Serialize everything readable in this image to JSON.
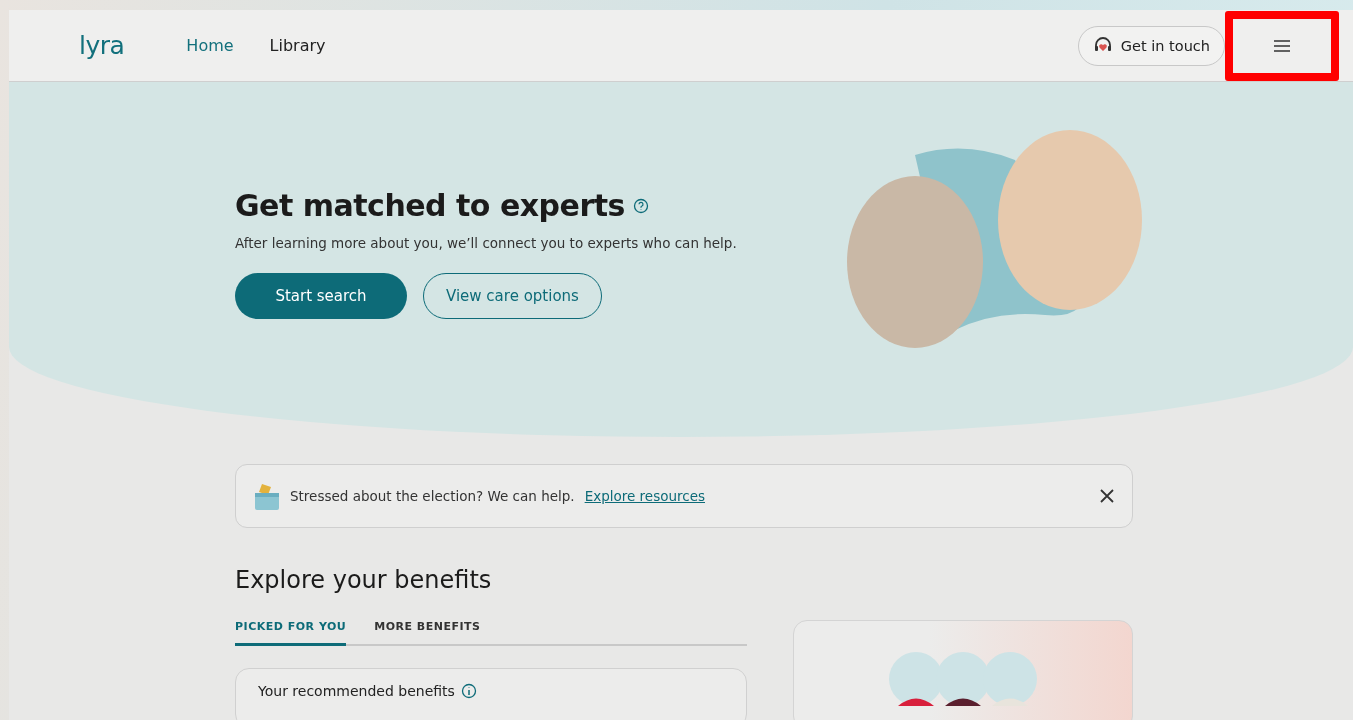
{
  "header": {
    "logo": "lyra",
    "nav": [
      {
        "label": "Home",
        "selected": true
      },
      {
        "label": "Library",
        "selected": false
      }
    ],
    "contact_button": "Get in touch",
    "menu_button": {
      "highlighted": true
    }
  },
  "hero": {
    "title": "Get matched to experts",
    "subtitle": "After learning more about you, we’ll connect you to experts who can help.",
    "buttons": [
      {
        "label": "Start search",
        "kind": "primary"
      },
      {
        "label": "View care options",
        "kind": "secondary"
      }
    ]
  },
  "banner": {
    "text": "Stressed about the election? We can help.",
    "link": "Explore resources"
  },
  "benefits": {
    "title": "Explore your benefits",
    "tabs": [
      {
        "label": "PICKED FOR YOU",
        "selected": true
      },
      {
        "label": "MORE BENEFITS",
        "selected": false
      }
    ],
    "card_title": "Your recommended benefits"
  }
}
